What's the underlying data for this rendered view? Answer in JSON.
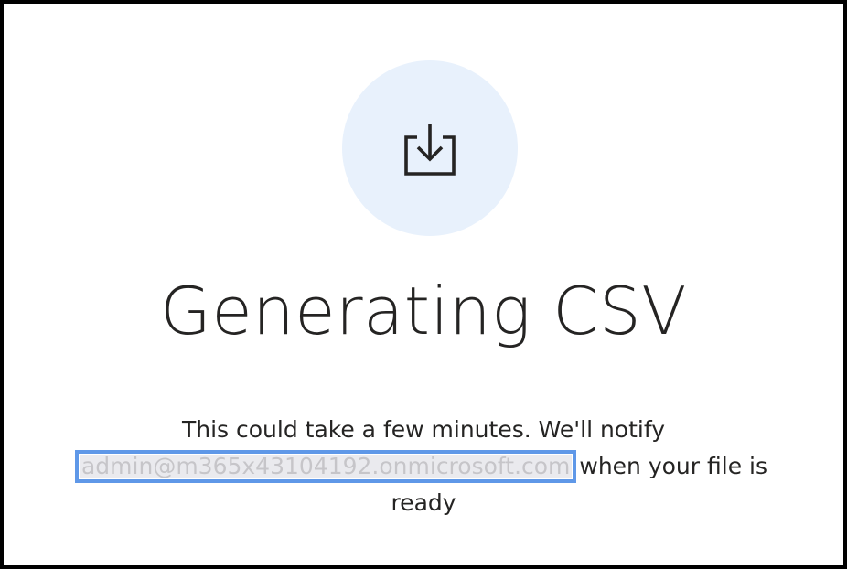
{
  "dialog": {
    "icon": "download-icon",
    "title": "Generating CSV",
    "message_lead": "This could take a few minutes. We'll notify",
    "email": "admin@m365x43104192.onmicrosoft.com",
    "message_tail": "when your file is ready"
  },
  "colors": {
    "icon_circle_bg": "#e8f1fc",
    "text": "#252423",
    "highlight_outline": "#5f98e8"
  }
}
